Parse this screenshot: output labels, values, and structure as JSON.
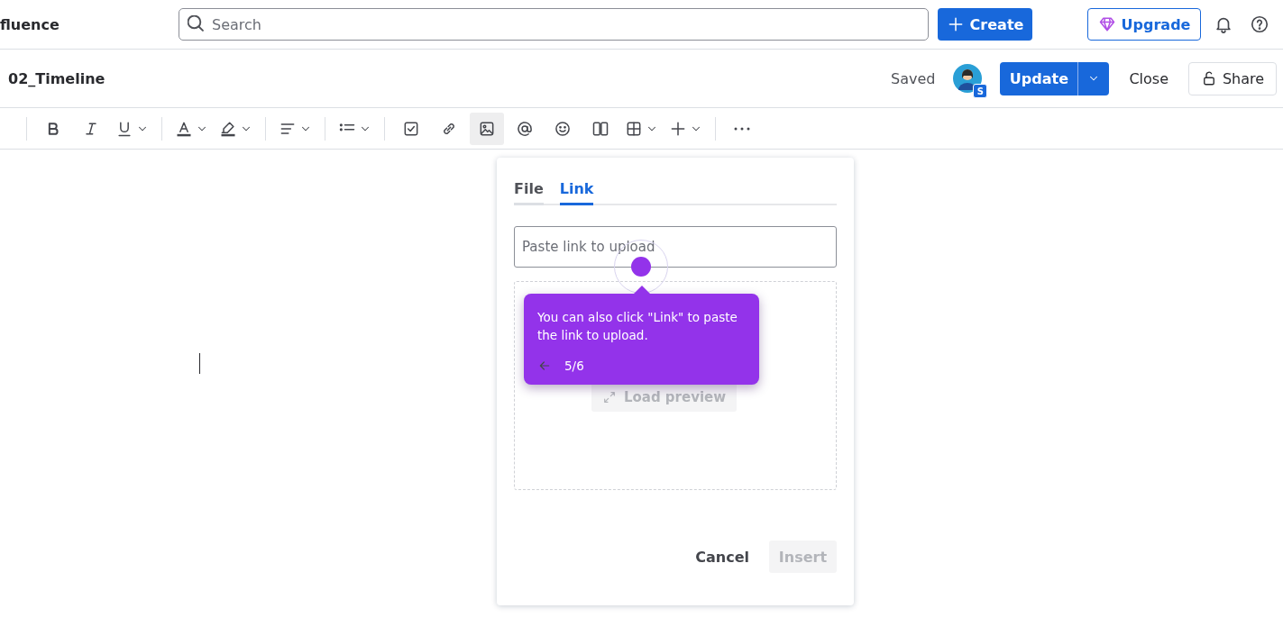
{
  "top_bar": {
    "logo_text": "fluence",
    "search": {
      "placeholder": "Search"
    },
    "create_button": "Create",
    "upgrade_button": "Upgrade"
  },
  "page_bar": {
    "title": "02_Timeline",
    "status": "Saved",
    "avatar_badge": "S",
    "update_button": "Update",
    "close_button": "Close",
    "share_button": "Share"
  },
  "toolbar": {
    "groups": [
      [
        {
          "selected": false,
          "dropdown": false
        },
        {
          "selected": false,
          "dropdown": false
        },
        {
          "selected": false,
          "dropdown": true
        }
      ],
      [
        {
          "selected": false,
          "dropdown": true
        },
        {
          "selected": false,
          "dropdown": true
        }
      ],
      [
        {
          "selected": false,
          "dropdown": true
        }
      ],
      [
        {
          "selected": false,
          "dropdown": true
        }
      ],
      [
        {
          "selected": false,
          "dropdown": false
        },
        {
          "selected": false,
          "dropdown": false
        },
        {
          "selected": true,
          "dropdown": false
        },
        {
          "selected": false,
          "dropdown": false
        },
        {
          "selected": false,
          "dropdown": false
        },
        {
          "selected": false,
          "dropdown": false
        },
        {
          "selected": false,
          "dropdown": true
        },
        {
          "selected": false,
          "dropdown": true
        }
      ],
      [
        {
          "selected": false,
          "dropdown": false
        }
      ]
    ]
  },
  "dialog": {
    "tabs": [
      {
        "label": "File",
        "selected": false
      },
      {
        "label": "Link",
        "selected": true
      }
    ],
    "link_field": {
      "placeholder": "Paste link to upload"
    },
    "load_preview_button": "Load preview",
    "cancel_button": "Cancel",
    "insert_button": {
      "label": "Insert",
      "disabled": true
    }
  },
  "tooltip": {
    "text": "You can also click \"Link\" to paste the link to upload.",
    "step": "5/6"
  }
}
